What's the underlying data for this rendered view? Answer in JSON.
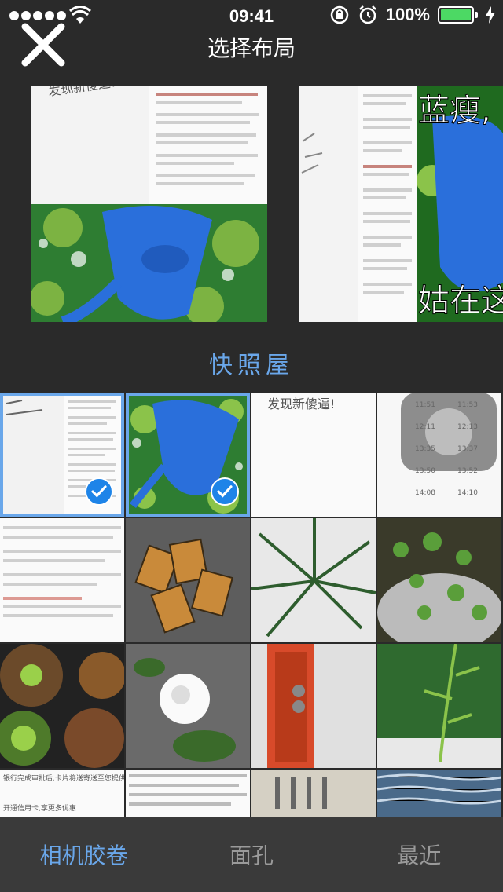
{
  "status": {
    "time": "09:41",
    "battery": "100%",
    "battery_level": 1.0,
    "icons": [
      "signal-dots-icon",
      "wifi-icon",
      "rotation-lock-icon",
      "alarm-icon",
      "battery-icon",
      "charging-icon"
    ]
  },
  "header": {
    "title": "选择布局",
    "close_icon": "close-icon"
  },
  "previews": {
    "layout_a_caption": "发现新傻逼!",
    "layout_b_caption_top": "蓝瘦,",
    "layout_b_caption_bottom": "姑在这"
  },
  "layout_name": "快照屋",
  "grid": {
    "selected_count": 2,
    "cells": [
      {
        "type": "screenshot-text",
        "selected": true
      },
      {
        "type": "blue-meme",
        "selected": true
      },
      {
        "type": "screenshot-text",
        "selected": false
      },
      {
        "type": "screenshot-clock",
        "selected": false
      },
      {
        "type": "screenshot-text",
        "selected": false
      },
      {
        "type": "photo-tiles",
        "selected": false
      },
      {
        "type": "photo-palm",
        "selected": false
      },
      {
        "type": "photo-plants",
        "selected": false
      },
      {
        "type": "photo-food",
        "selected": false
      },
      {
        "type": "photo-flower",
        "selected": false
      },
      {
        "type": "photo-red-door",
        "selected": false
      },
      {
        "type": "photo-green",
        "selected": false
      },
      {
        "type": "screenshot-text",
        "selected": false
      },
      {
        "type": "screenshot-text",
        "selected": false
      },
      {
        "type": "photo-paper",
        "selected": false
      },
      {
        "type": "photo-water",
        "selected": false
      }
    ],
    "visible_texts": {
      "cell1_caption": "发现新傻逼!",
      "cell9_line1": "银行完成审批后,卡片将送寄送至您提供的地址。",
      "cell9_line2": "开通信用卡,享更多优惠",
      "clock_times": [
        "11:51",
        "11:53",
        "12:11",
        "12:13",
        "13:35",
        "13:37",
        "13:50",
        "13:52",
        "14:08",
        "14:10"
      ]
    }
  },
  "tabs": {
    "items": [
      "相机胶卷",
      "面孔",
      "最近"
    ],
    "active": 0
  },
  "colors": {
    "accent": "#6aa7ea",
    "background": "#2a2a2a",
    "tab_bar": "#3a3a3a",
    "check": "#1e84e8",
    "battery": "#4cd964"
  }
}
